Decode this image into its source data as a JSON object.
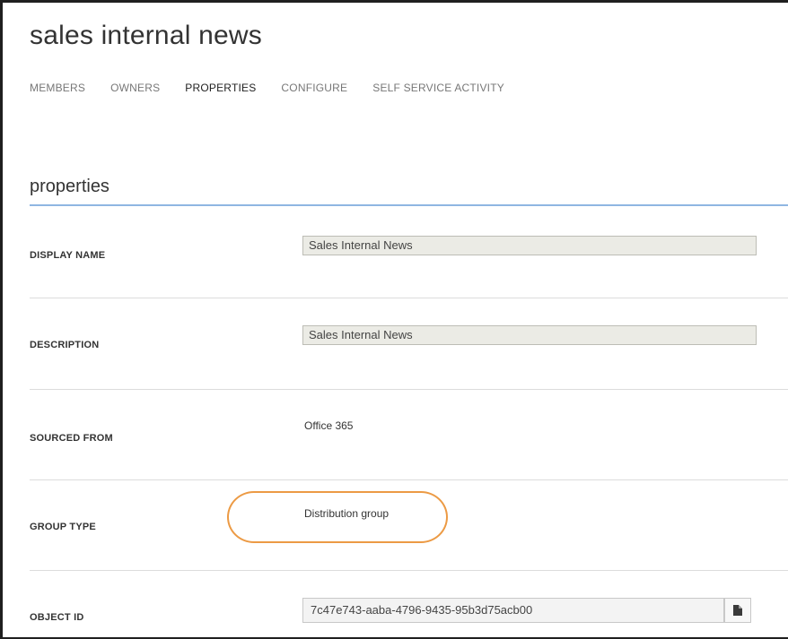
{
  "header": {
    "title": "sales internal news"
  },
  "tabs": [
    {
      "label": "MEMBERS",
      "active": false
    },
    {
      "label": "OWNERS",
      "active": false
    },
    {
      "label": "PROPERTIES",
      "active": true
    },
    {
      "label": "CONFIGURE",
      "active": false
    },
    {
      "label": "SELF SERVICE ACTIVITY",
      "active": false
    }
  ],
  "section": {
    "title": "properties"
  },
  "properties": {
    "display_name": {
      "label": "DISPLAY NAME",
      "value": "Sales Internal News"
    },
    "description": {
      "label": "DESCRIPTION",
      "value": "Sales Internal News"
    },
    "sourced_from": {
      "label": "SOURCED FROM",
      "value": "Office 365"
    },
    "group_type": {
      "label": "GROUP TYPE",
      "value": "Distribution group"
    },
    "object_id": {
      "label": "OBJECT ID",
      "value": "7c47e743-aaba-4796-9435-95b3d75acb00"
    }
  },
  "icons": {
    "copy": "copy-icon"
  },
  "colors": {
    "accent_rule": "#8fb6e2",
    "highlight": "#ec9a44",
    "field_bg": "#ebebe5"
  }
}
